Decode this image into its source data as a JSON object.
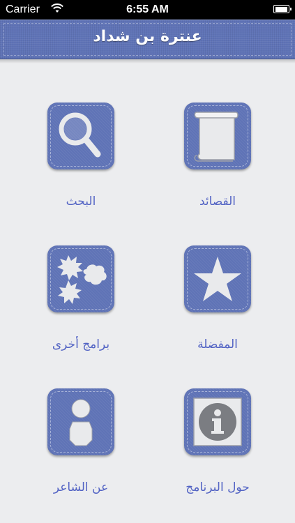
{
  "status_bar": {
    "carrier": "Carrier",
    "time": "6:55 AM",
    "battery_level": 1.0
  },
  "nav": {
    "title": "عنترة بن شداد"
  },
  "colors": {
    "tile": "#5f73b6",
    "label": "#5263c4",
    "background": "#ecedef"
  },
  "menu": [
    {
      "label": "القصائد",
      "icon": "scroll-icon"
    },
    {
      "label": "البحث",
      "icon": "search-icon"
    },
    {
      "label": "المفضلة",
      "icon": "star-icon"
    },
    {
      "label": "برامج أخرى",
      "icon": "bursts-icon"
    },
    {
      "label": "حول البرنامج",
      "icon": "info-icon"
    },
    {
      "label": "عن الشاعر",
      "icon": "poet-icon"
    }
  ]
}
